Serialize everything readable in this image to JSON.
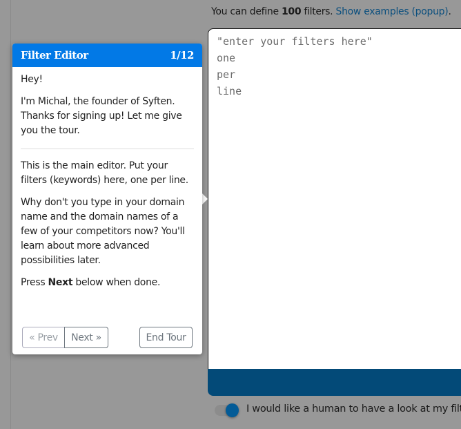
{
  "intro": {
    "prefix": "You can define ",
    "count": "100",
    "suffix": " filters. ",
    "link": "Show examples (popup)",
    "end": "."
  },
  "editor": {
    "placeholder": "\"enter your filters here\"\none\nper\nline"
  },
  "toggle": {
    "label": "I would like a human to have a look at my filters",
    "on": true
  },
  "tour": {
    "title": "Filter Editor",
    "step": "1/12",
    "p1": "Hey!",
    "p2": "I'm Michal, the founder of Syften. Thanks for signing up! Let me give you the tour.",
    "p3": "This is the main editor. Put your filters (keywords) here, one per line.",
    "p4": "Why don't you type in your domain name and the domain names of a few of your competitors now? You'll learn about more advanced possibilities later.",
    "p5_pre": "Press ",
    "p5_bold": "Next",
    "p5_post": " below when done.",
    "prev": "« Prev",
    "next": "Next »",
    "end": "End Tour"
  },
  "colors": {
    "accent": "#0279e6",
    "bar": "#034a78",
    "link": "#0b4f7e"
  }
}
